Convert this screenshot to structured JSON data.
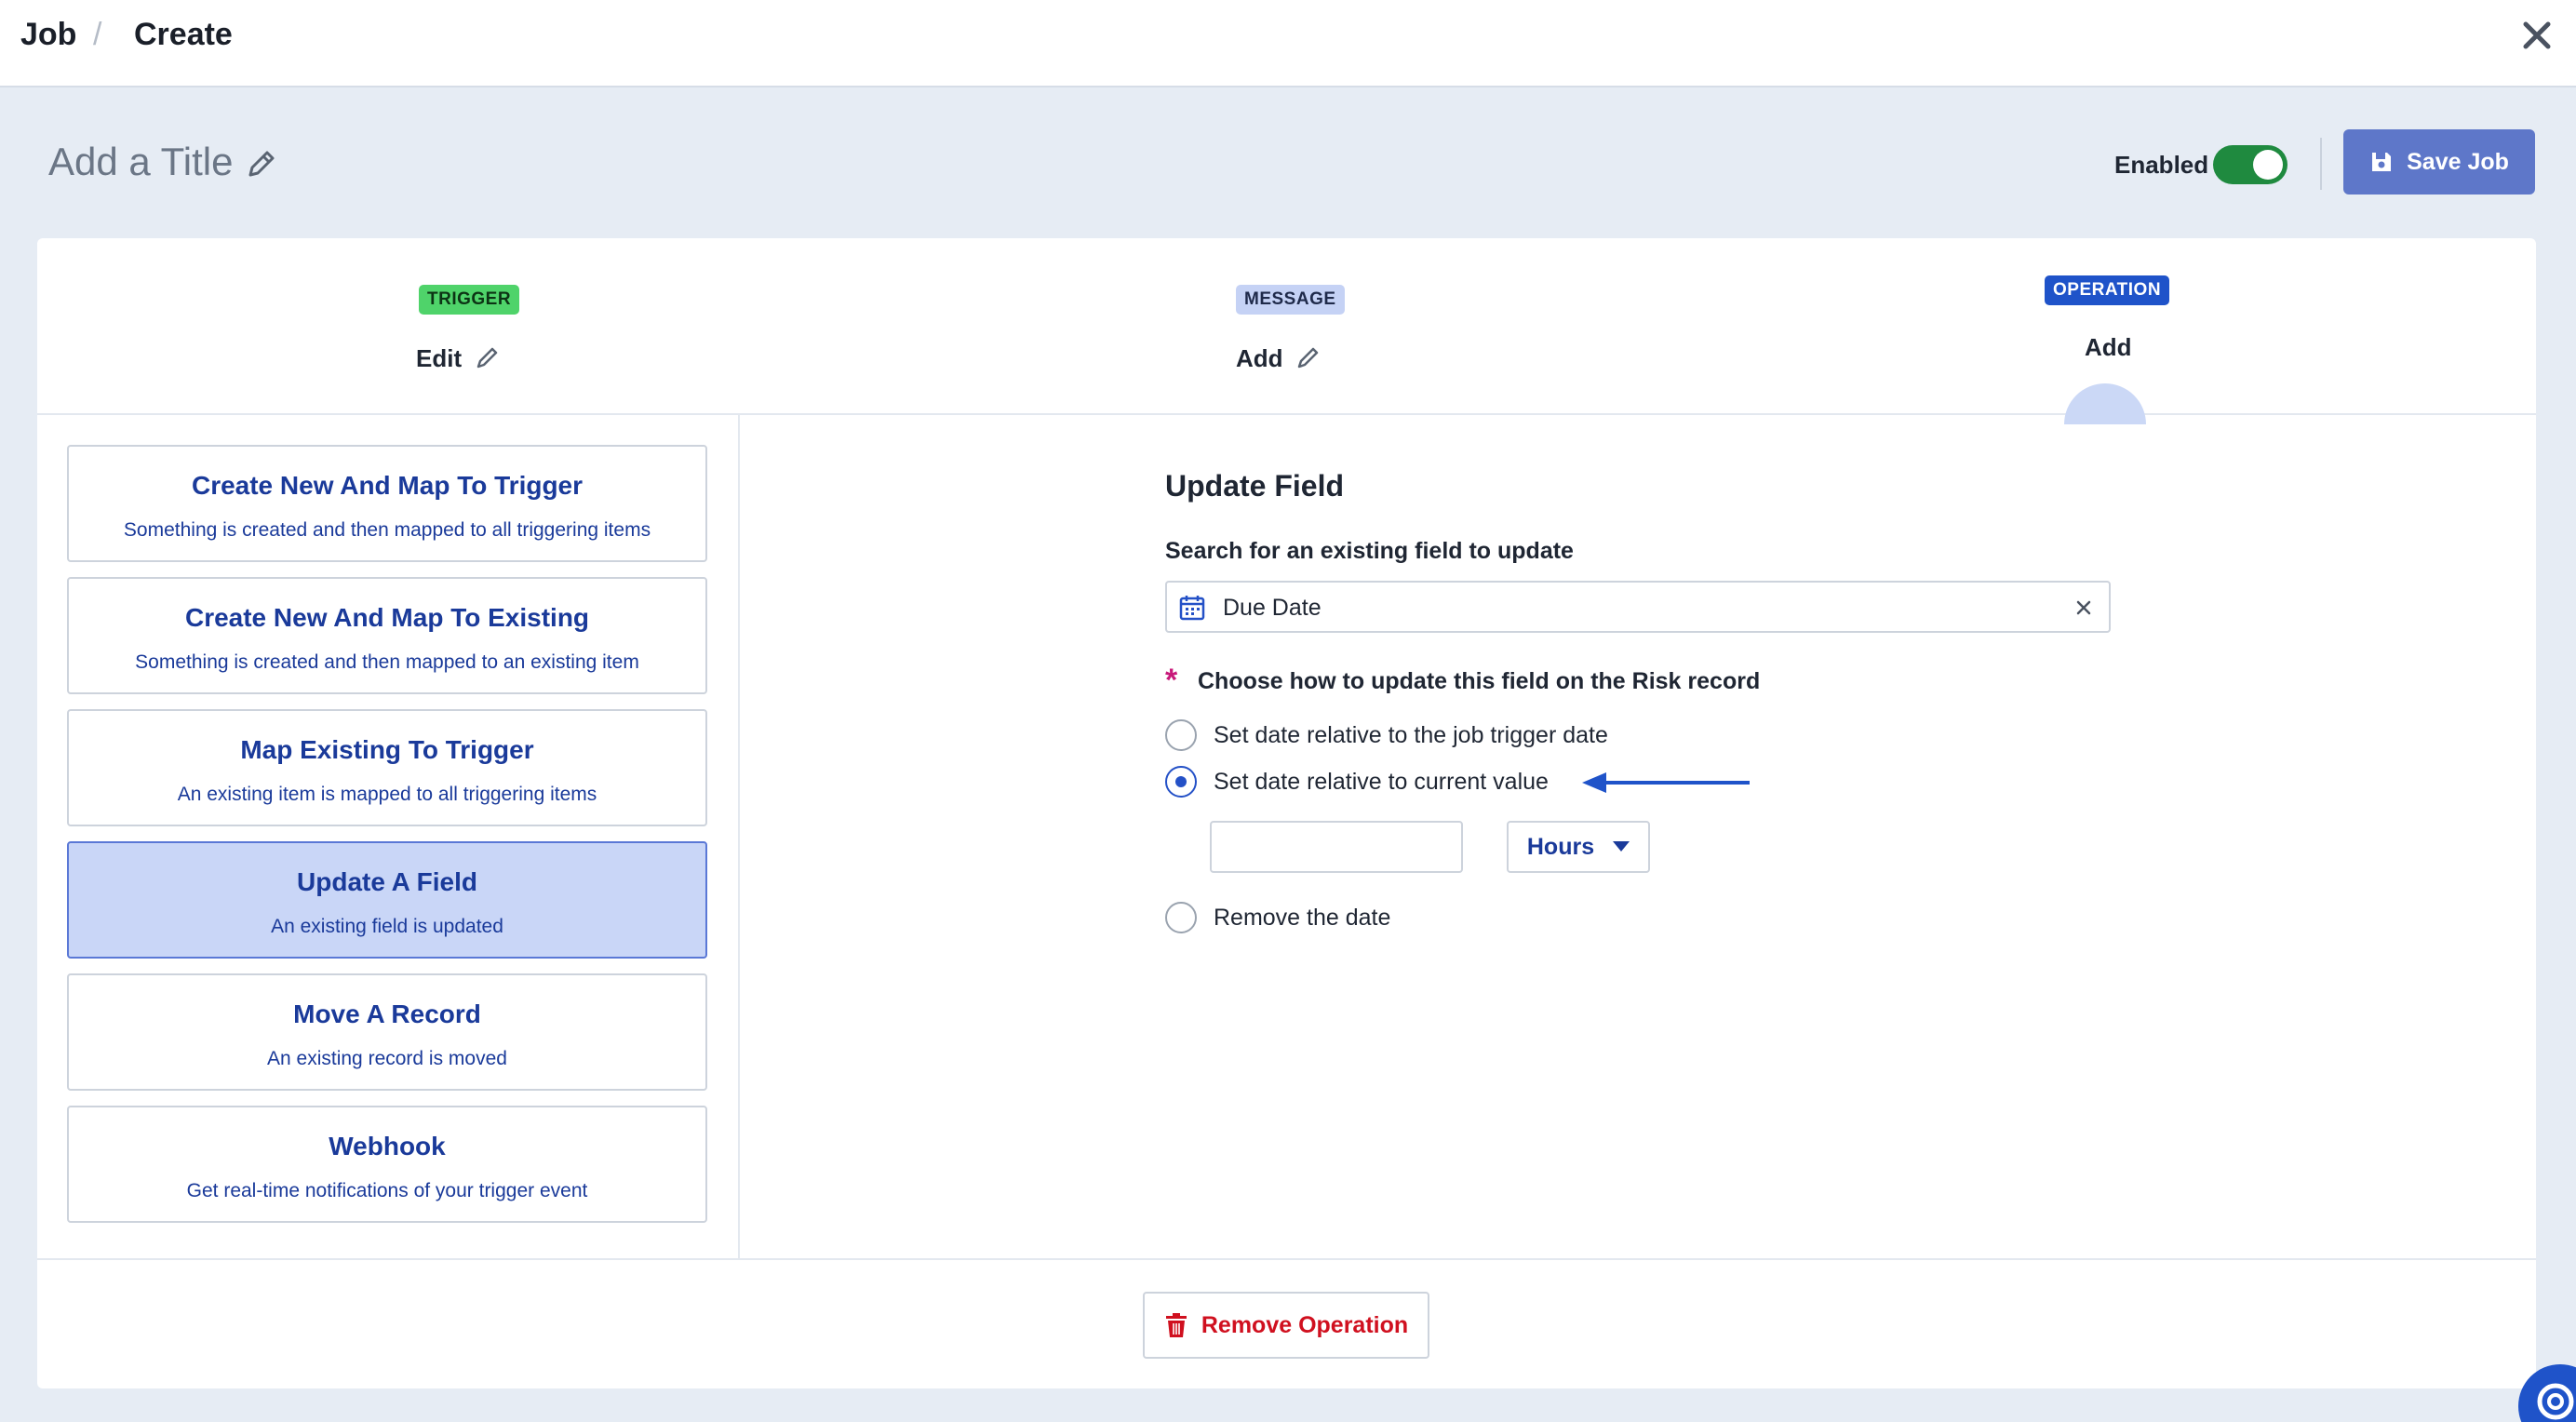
{
  "breadcrumb": {
    "root": "Job",
    "separator": "/",
    "current": "Create"
  },
  "header": {
    "title_placeholder": "Add a Title",
    "enabled_label": "Enabled",
    "enabled": true,
    "save_label": "Save Job"
  },
  "steps": [
    {
      "badge": "TRIGGER",
      "label": "Edit"
    },
    {
      "badge": "MESSAGE",
      "label": "Add"
    },
    {
      "badge": "OPERATION",
      "label": "Add"
    }
  ],
  "operations": [
    {
      "title": "Create New And Map To Trigger",
      "desc": "Something is created and then mapped to all triggering items",
      "selected": false
    },
    {
      "title": "Create New And Map To Existing",
      "desc": "Something is created and then mapped to an existing item",
      "selected": false
    },
    {
      "title": "Map Existing To Trigger",
      "desc": "An existing item is mapped to all triggering items",
      "selected": false
    },
    {
      "title": "Update A Field",
      "desc": "An existing field is updated",
      "selected": true
    },
    {
      "title": "Move A Record",
      "desc": "An existing record is moved",
      "selected": false
    },
    {
      "title": "Webhook",
      "desc": "Get real-time notifications of your trigger event",
      "selected": false
    }
  ],
  "update_field": {
    "title": "Update Field",
    "search_label": "Search for an existing field to update",
    "search_value": "Due Date",
    "required_mark": "*",
    "choose_label": "Choose how to update this field on the Risk record",
    "options": [
      {
        "label": "Set date relative to the job trigger date",
        "checked": false
      },
      {
        "label": "Set date relative to current value",
        "checked": true
      },
      {
        "label": "Remove the date",
        "checked": false
      }
    ],
    "amount_value": "",
    "unit_selected": "Hours"
  },
  "footer": {
    "remove_label": "Remove Operation"
  },
  "colors": {
    "accent": "#1f53c9",
    "save_button": "#5e77c9",
    "toggle_on": "#1f8a3f",
    "trigger_badge": "#4fd36a",
    "danger": "#d0101f"
  }
}
